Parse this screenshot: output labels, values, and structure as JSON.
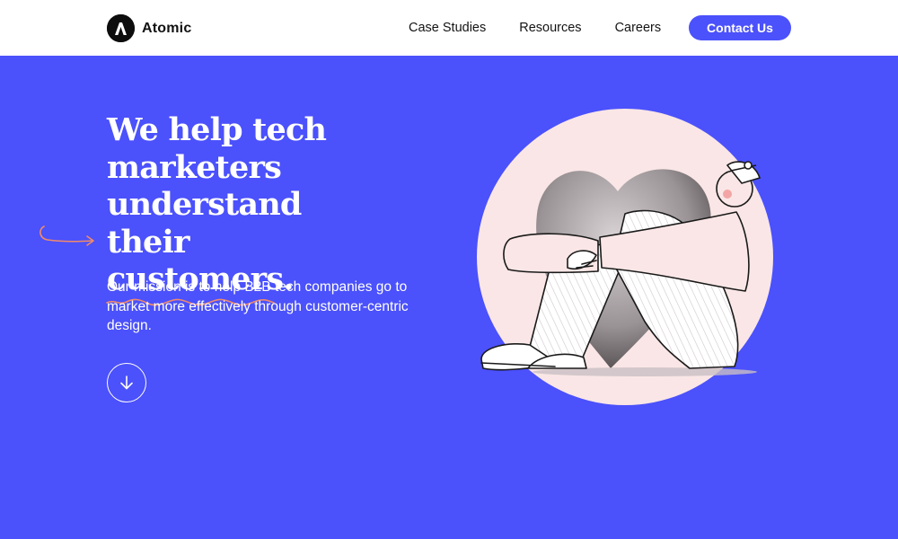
{
  "header": {
    "logo_text": "Atomic",
    "nav": [
      {
        "label": "Case Studies"
      },
      {
        "label": "Resources"
      },
      {
        "label": "Careers"
      }
    ],
    "cta_label": "Contact Us"
  },
  "hero": {
    "headline_lines": [
      "We help tech",
      "marketers",
      "understand"
    ],
    "headline_last_prefix": "their ",
    "headline_highlight": "customers.",
    "mission": "Our mission is to help B2B tech companies go to market more effectively through customer-centric design."
  },
  "colors": {
    "brand_blue": "#4b51fb",
    "accent_orange": "#f08a6b",
    "circle_pink": "#fae6e6",
    "white": "#ffffff"
  },
  "icons": {
    "logo": "atomic-logo-icon",
    "scroll": "arrow-down-icon",
    "decor_arrow": "curved-arrow-icon"
  }
}
